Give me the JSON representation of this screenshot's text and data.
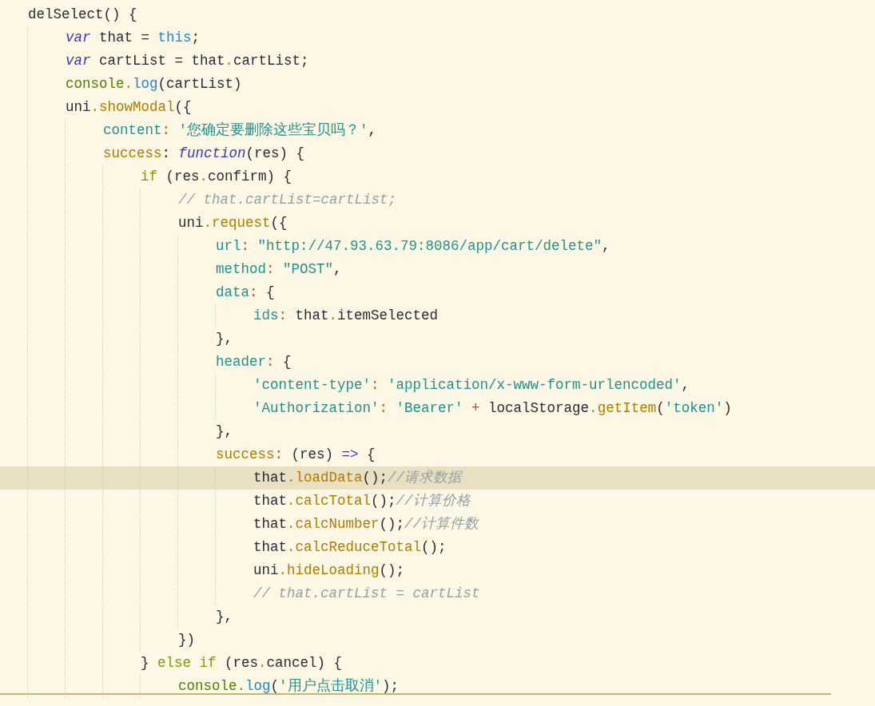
{
  "editor": {
    "lines": [
      {
        "highlighted": false,
        "tokens": [
          {
            "kind": "plain",
            "t": "delSelect() {"
          }
        ],
        "children": [
          {
            "highlighted": false,
            "tokens": [
              {
                "kind": "kw",
                "t": "var"
              },
              {
                "kind": "plain",
                "t": " that = "
              },
              {
                "kind": "this",
                "t": "this"
              },
              {
                "kind": "plain",
                "t": ";"
              }
            ]
          },
          {
            "highlighted": false,
            "tokens": [
              {
                "kind": "kw",
                "t": "var"
              },
              {
                "kind": "plain",
                "t": " cartList = that"
              },
              {
                "kind": "dot",
                "t": "."
              },
              {
                "kind": "plain",
                "t": "cartList;"
              }
            ]
          },
          {
            "highlighted": false,
            "tokens": [
              {
                "kind": "obj",
                "t": "console"
              },
              {
                "kind": "dot",
                "t": "."
              },
              {
                "kind": "fn",
                "t": "log"
              },
              {
                "kind": "plain",
                "t": "(cartList)"
              }
            ]
          },
          {
            "highlighted": false,
            "tokens": [
              {
                "kind": "plain",
                "t": "uni"
              },
              {
                "kind": "dot",
                "t": "."
              },
              {
                "kind": "method",
                "t": "showModal"
              },
              {
                "kind": "plain",
                "t": "({"
              }
            ],
            "children": [
              {
                "highlighted": false,
                "tokens": [
                  {
                    "kind": "prop",
                    "t": "content"
                  },
                  {
                    "kind": "colon",
                    "t": ": "
                  },
                  {
                    "kind": "str",
                    "t": "'您确定要删除这些宝贝吗？'"
                  },
                  {
                    "kind": "plain",
                    "t": ","
                  }
                ]
              },
              {
                "highlighted": false,
                "tokens": [
                  {
                    "kind": "method",
                    "t": "success"
                  },
                  {
                    "kind": "plain",
                    "t": ": "
                  },
                  {
                    "kind": "kw",
                    "t": "function"
                  },
                  {
                    "kind": "plain",
                    "t": "(res) {"
                  }
                ],
                "children": [
                  {
                    "highlighted": false,
                    "tokens": [
                      {
                        "kind": "cond",
                        "t": "if"
                      },
                      {
                        "kind": "plain",
                        "t": " (res"
                      },
                      {
                        "kind": "dot",
                        "t": "."
                      },
                      {
                        "kind": "plain",
                        "t": "confirm) {"
                      }
                    ],
                    "children": [
                      {
                        "highlighted": false,
                        "tokens": [
                          {
                            "kind": "comment",
                            "t": "// that.cartList=cartList;"
                          }
                        ]
                      },
                      {
                        "highlighted": false,
                        "tokens": [
                          {
                            "kind": "plain",
                            "t": "uni"
                          },
                          {
                            "kind": "dot",
                            "t": "."
                          },
                          {
                            "kind": "method",
                            "t": "request"
                          },
                          {
                            "kind": "plain",
                            "t": "({"
                          }
                        ],
                        "children": [
                          {
                            "highlighted": false,
                            "tokens": [
                              {
                                "kind": "prop",
                                "t": "url"
                              },
                              {
                                "kind": "colon",
                                "t": ": "
                              },
                              {
                                "kind": "str",
                                "t": "\"http://47.93.63.79:8086/app/cart/delete\""
                              },
                              {
                                "kind": "plain",
                                "t": ","
                              }
                            ]
                          },
                          {
                            "highlighted": false,
                            "tokens": [
                              {
                                "kind": "prop",
                                "t": "method"
                              },
                              {
                                "kind": "colon",
                                "t": ": "
                              },
                              {
                                "kind": "str",
                                "t": "\"POST\""
                              },
                              {
                                "kind": "plain",
                                "t": ","
                              }
                            ]
                          },
                          {
                            "highlighted": false,
                            "tokens": [
                              {
                                "kind": "prop",
                                "t": "data"
                              },
                              {
                                "kind": "colon",
                                "t": ":"
                              },
                              {
                                "kind": "plain",
                                "t": " {"
                              }
                            ],
                            "children": [
                              {
                                "highlighted": false,
                                "tokens": [
                                  {
                                    "kind": "prop",
                                    "t": "ids"
                                  },
                                  {
                                    "kind": "colon",
                                    "t": ":"
                                  },
                                  {
                                    "kind": "plain",
                                    "t": " that"
                                  },
                                  {
                                    "kind": "dot",
                                    "t": "."
                                  },
                                  {
                                    "kind": "plain",
                                    "t": "itemSelected"
                                  }
                                ]
                              }
                            ]
                          },
                          {
                            "highlighted": false,
                            "tokens": [
                              {
                                "kind": "plain",
                                "t": "},"
                              }
                            ]
                          },
                          {
                            "highlighted": false,
                            "tokens": [
                              {
                                "kind": "prop",
                                "t": "header"
                              },
                              {
                                "kind": "colon",
                                "t": ":"
                              },
                              {
                                "kind": "plain",
                                "t": " {"
                              }
                            ],
                            "children": [
                              {
                                "highlighted": false,
                                "tokens": [
                                  {
                                    "kind": "str",
                                    "t": "'content-type'"
                                  },
                                  {
                                    "kind": "colon",
                                    "t": ": "
                                  },
                                  {
                                    "kind": "str",
                                    "t": "'application/x-www-form-urlencoded'"
                                  },
                                  {
                                    "kind": "plain",
                                    "t": ","
                                  }
                                ]
                              },
                              {
                                "highlighted": false,
                                "tokens": [
                                  {
                                    "kind": "str",
                                    "t": "'Authorization'"
                                  },
                                  {
                                    "kind": "colon",
                                    "t": ": "
                                  },
                                  {
                                    "kind": "str",
                                    "t": "'Bearer'"
                                  },
                                  {
                                    "kind": "colon",
                                    "t": " + "
                                  },
                                  {
                                    "kind": "plain",
                                    "t": "localStorage"
                                  },
                                  {
                                    "kind": "dot",
                                    "t": "."
                                  },
                                  {
                                    "kind": "method",
                                    "t": "getItem"
                                  },
                                  {
                                    "kind": "plain",
                                    "t": "("
                                  },
                                  {
                                    "kind": "str",
                                    "t": "'token'"
                                  },
                                  {
                                    "kind": "plain",
                                    "t": ")"
                                  }
                                ]
                              }
                            ]
                          },
                          {
                            "highlighted": false,
                            "tokens": [
                              {
                                "kind": "plain",
                                "t": "},"
                              }
                            ]
                          },
                          {
                            "highlighted": false,
                            "tokens": [
                              {
                                "kind": "method",
                                "t": "success"
                              },
                              {
                                "kind": "colon",
                                "t": ":"
                              },
                              {
                                "kind": "plain",
                                "t": " (res) "
                              },
                              {
                                "kind": "arrow",
                                "t": "=>"
                              },
                              {
                                "kind": "plain",
                                "t": " {"
                              }
                            ],
                            "children": [
                              {
                                "highlighted": true,
                                "tokens": [
                                  {
                                    "kind": "plain",
                                    "t": "that"
                                  },
                                  {
                                    "kind": "dot",
                                    "t": "."
                                  },
                                  {
                                    "kind": "method",
                                    "t": "loadData"
                                  },
                                  {
                                    "kind": "plain",
                                    "t": "();"
                                  },
                                  {
                                    "kind": "comment",
                                    "t": "//请求数据"
                                  }
                                ]
                              },
                              {
                                "highlighted": false,
                                "tokens": [
                                  {
                                    "kind": "plain",
                                    "t": "that"
                                  },
                                  {
                                    "kind": "dot",
                                    "t": "."
                                  },
                                  {
                                    "kind": "method",
                                    "t": "calcTotal"
                                  },
                                  {
                                    "kind": "plain",
                                    "t": "();"
                                  },
                                  {
                                    "kind": "comment",
                                    "t": "//计算价格"
                                  }
                                ]
                              },
                              {
                                "highlighted": false,
                                "tokens": [
                                  {
                                    "kind": "plain",
                                    "t": "that"
                                  },
                                  {
                                    "kind": "dot",
                                    "t": "."
                                  },
                                  {
                                    "kind": "method",
                                    "t": "calcNumber"
                                  },
                                  {
                                    "kind": "plain",
                                    "t": "();"
                                  },
                                  {
                                    "kind": "comment",
                                    "t": "//计算件数"
                                  }
                                ]
                              },
                              {
                                "highlighted": false,
                                "tokens": [
                                  {
                                    "kind": "plain",
                                    "t": "that"
                                  },
                                  {
                                    "kind": "dot",
                                    "t": "."
                                  },
                                  {
                                    "kind": "method",
                                    "t": "calcReduceTotal"
                                  },
                                  {
                                    "kind": "plain",
                                    "t": "();"
                                  }
                                ]
                              },
                              {
                                "highlighted": false,
                                "tokens": [
                                  {
                                    "kind": "plain",
                                    "t": "uni"
                                  },
                                  {
                                    "kind": "dot",
                                    "t": "."
                                  },
                                  {
                                    "kind": "method",
                                    "t": "hideLoading"
                                  },
                                  {
                                    "kind": "plain",
                                    "t": "();"
                                  }
                                ]
                              },
                              {
                                "highlighted": false,
                                "tokens": [
                                  {
                                    "kind": "comment",
                                    "t": "// that.cartList = cartList"
                                  }
                                ]
                              }
                            ]
                          },
                          {
                            "highlighted": false,
                            "tokens": [
                              {
                                "kind": "plain",
                                "t": "},"
                              }
                            ]
                          }
                        ]
                      },
                      {
                        "highlighted": false,
                        "tokens": [
                          {
                            "kind": "plain",
                            "t": "})"
                          }
                        ]
                      }
                    ]
                  },
                  {
                    "highlighted": false,
                    "tokens": [
                      {
                        "kind": "plain",
                        "t": "} "
                      },
                      {
                        "kind": "cond",
                        "t": "else if"
                      },
                      {
                        "kind": "plain",
                        "t": " (res"
                      },
                      {
                        "kind": "dot",
                        "t": "."
                      },
                      {
                        "kind": "plain",
                        "t": "cancel) {"
                      }
                    ],
                    "children": [
                      {
                        "highlighted": false,
                        "tokens": [
                          {
                            "kind": "obj",
                            "t": "console"
                          },
                          {
                            "kind": "dot",
                            "t": "."
                          },
                          {
                            "kind": "fn",
                            "t": "log"
                          },
                          {
                            "kind": "plain",
                            "t": "("
                          },
                          {
                            "kind": "str",
                            "t": "'用户点击取消'"
                          },
                          {
                            "kind": "plain",
                            "t": ");"
                          }
                        ]
                      }
                    ]
                  }
                ]
              }
            ]
          }
        ]
      }
    ]
  }
}
